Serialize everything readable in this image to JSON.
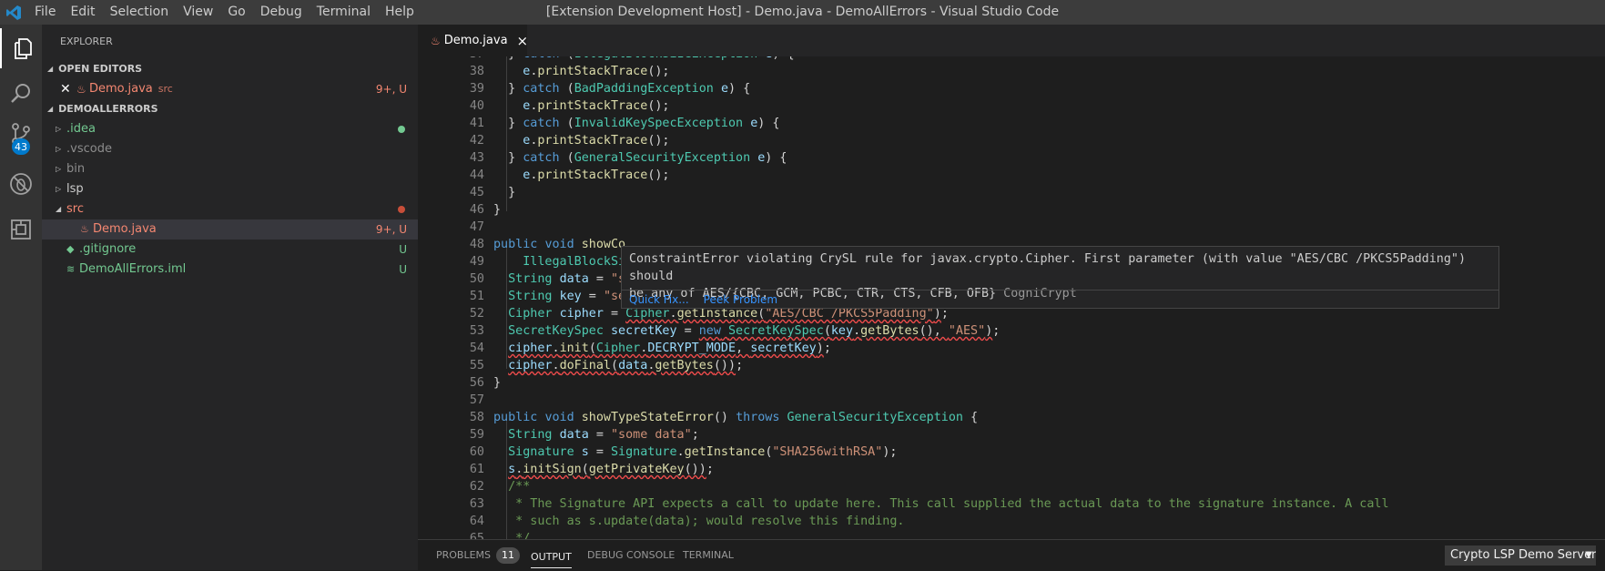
{
  "titlebar": {
    "menu": [
      "File",
      "Edit",
      "Selection",
      "View",
      "Go",
      "Debug",
      "Terminal",
      "Help"
    ],
    "window_title": "[Extension Development Host] - Demo.java - DemoAllErrors - Visual Studio Code"
  },
  "activity": {
    "icons": [
      "explorer-icon",
      "search-icon",
      "source-control-icon",
      "debug-icon",
      "extensions-icon"
    ],
    "badge": "43"
  },
  "sidebar": {
    "title": "EXPLORER",
    "open_editors": {
      "label": "OPEN EDITORS",
      "item": {
        "name": "Demo.java",
        "path": "src",
        "status": "9+, U"
      }
    },
    "workspace": {
      "label": "DEMOALLERRORS",
      "items": [
        {
          "name": ".idea",
          "folder": true,
          "indent": 1,
          "status": "",
          "dot": "#73c991",
          "color": "#73c991"
        },
        {
          "name": ".vscode",
          "folder": true,
          "indent": 1,
          "status": "",
          "dot": "",
          "color": "#8c8c8c"
        },
        {
          "name": "bin",
          "folder": true,
          "indent": 1,
          "status": "",
          "dot": "",
          "color": "#8c8c8c"
        },
        {
          "name": "lsp",
          "folder": true,
          "indent": 1,
          "status": "",
          "dot": "",
          "color": "#cccccc"
        },
        {
          "name": "src",
          "folder": true,
          "open": true,
          "indent": 1,
          "status": "",
          "dot": "#c74e39",
          "color": "#f48771"
        },
        {
          "name": "Demo.java",
          "folder": false,
          "indent": 2,
          "status": "9+, U",
          "dot": "",
          "color": "#f48771",
          "selected": true
        },
        {
          "name": ".gitignore",
          "folder": false,
          "indent": 1,
          "status": "U",
          "dot": "",
          "color": "#73c991"
        },
        {
          "name": "DemoAllErrors.iml",
          "folder": false,
          "indent": 1,
          "status": "U",
          "dot": "",
          "color": "#73c991"
        }
      ]
    }
  },
  "editor": {
    "tab": {
      "label": "Demo.java",
      "close": "×"
    },
    "hover": {
      "message_line1": "ConstraintError violating CrySL rule for javax.crypto.Cipher. First parameter (with value \"AES/CBC /PKCS5Padding\") should",
      "message_line2": "be any of AES/{CBC, GCM, PCBC, CTR, CTS, CFB, OFB}",
      "source": "CogniCrypt",
      "action_quickfix": "Quick Fix...",
      "action_peek": "Peek Problem"
    }
  },
  "panel": {
    "tabs": [
      {
        "label": "PROBLEMS",
        "count": "11"
      },
      {
        "label": "OUTPUT"
      },
      {
        "label": "DEBUG CONSOLE"
      },
      {
        "label": "TERMINAL"
      }
    ],
    "select_value": "Crypto LSP Demo Server"
  }
}
